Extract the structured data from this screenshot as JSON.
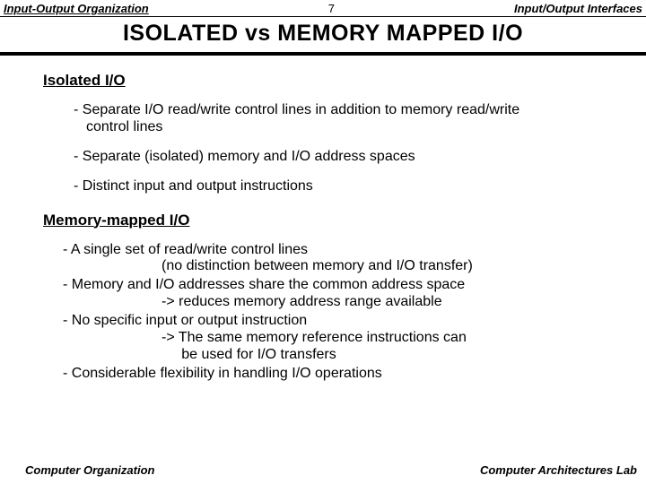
{
  "header": {
    "left": "Input-Output Organization",
    "page": "7",
    "right": "Input/Output Interfaces"
  },
  "title": "ISOLATED  vs  MEMORY  MAPPED  I/O",
  "sections": {
    "isolated": {
      "heading": "Isolated I/O",
      "items": [
        {
          "line1": "- Separate I/O read/write control lines in addition to memory read/write",
          "line2": "control lines"
        },
        {
          "line1": "- Separate (isolated) memory and I/O address spaces"
        },
        {
          "line1": "- Distinct input and output instructions"
        }
      ]
    },
    "mapped": {
      "heading": "Memory-mapped I/O",
      "items": [
        {
          "line1": "- A single set of read/write control lines",
          "sub": "(no distinction between memory and I/O transfer)"
        },
        {
          "line1": "- Memory and I/O addresses share the common address space",
          "sub": "-> reduces memory address range available"
        },
        {
          "line1": "- No specific input or output instruction",
          "sub": "-> The same memory reference instructions can",
          "sub2": "     be used for I/O transfers"
        },
        {
          "line1": "- Considerable flexibility in handling I/O operations"
        }
      ]
    }
  },
  "footer": {
    "left": "Computer Organization",
    "right": "Computer Architectures Lab"
  }
}
